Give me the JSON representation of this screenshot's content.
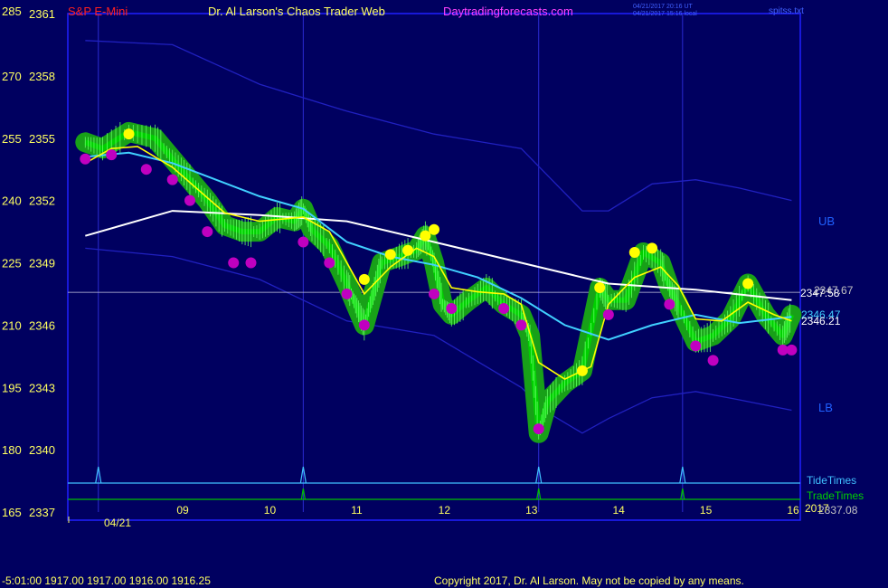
{
  "header": {
    "instrument": "S&P E-Mini",
    "title": "Dr. Al Larson's Chaos Trader Web",
    "site": "Daytradingforecasts.com",
    "stamp_utc": "04/21/2017 20:16 UT",
    "stamp_local": "04/21/2017 15:16 local",
    "file": "spitss.txt"
  },
  "footer": {
    "quote": "-5:01:00  1917.00 1917.00 1916.00 1916.25",
    "copyright": "Copyright 2017, Dr. Al Larson. May not be copied by any means."
  },
  "colors": {
    "background": "#000060",
    "frame": "#2020ff",
    "price": "#00d000",
    "yellow_dot": "#ffff00",
    "magenta_dot": "#c000c0",
    "bands": "#2020c0",
    "cyan_avg": "#40d0ff",
    "white_avg": "#ffffff",
    "yellow_avg": "#ffff00",
    "label_yellow": "#ffff60",
    "tide": "#40c0ff",
    "trade": "#00c000"
  },
  "chart_data": {
    "type": "line",
    "title": "S&P E-Mini",
    "y_left_ticks": [
      "285",
      "270",
      "255",
      "240",
      "225",
      "210",
      "195",
      "180",
      "165"
    ],
    "y_right_ticks": [
      "2361",
      "2358",
      "2355",
      "2352",
      "2349",
      "2346",
      "2343",
      "2340",
      "2337"
    ],
    "ylim": [
      2337,
      2361
    ],
    "x_ticks": [
      "09",
      "10",
      "11",
      "12",
      "13",
      "14",
      "15",
      "16"
    ],
    "x_date": "04/21",
    "band_labels": {
      "upper": "UB",
      "lower": "LB"
    },
    "right_labels": [
      "2347.67",
      "2347.58",
      "2346.47",
      "2346.21",
      "2337.08"
    ],
    "tide_label": "TideTimes",
    "trade_label": "TradeTimes",
    "year_label": "2017",
    "price_series": [
      [
        "8.0",
        2354.8
      ],
      [
        "8.2",
        2354.5
      ],
      [
        "8.5",
        2355.3
      ],
      [
        "8.8",
        2355.0
      ],
      [
        "9.0",
        2354.0
      ],
      [
        "9.2",
        2353.0
      ],
      [
        "9.4",
        2352.0
      ],
      [
        "9.6",
        2350.8
      ],
      [
        "9.8",
        2350.5
      ],
      [
        "10.0",
        2350.5
      ],
      [
        "10.2",
        2351.2
      ],
      [
        "10.4",
        2351.0
      ],
      [
        "10.5",
        2351.6
      ],
      [
        "10.6",
        2350.6
      ],
      [
        "10.8",
        2349.8
      ],
      [
        "11.0",
        2348.0
      ],
      [
        "11.1",
        2347.0
      ],
      [
        "11.2",
        2346.0
      ],
      [
        "11.3",
        2347.5
      ],
      [
        "11.4",
        2349.0
      ],
      [
        "11.6",
        2349.3
      ],
      [
        "11.8",
        2349.6
      ],
      [
        "11.9",
        2350.3
      ],
      [
        "12.0",
        2349.0
      ],
      [
        "12.1",
        2347.0
      ],
      [
        "12.2",
        2346.5
      ],
      [
        "12.4",
        2347.2
      ],
      [
        "12.6",
        2347.8
      ],
      [
        "12.8",
        2347.0
      ],
      [
        "13.0",
        2346.5
      ],
      [
        "13.1",
        2345.5
      ],
      [
        "13.2",
        2340.8
      ],
      [
        "13.3",
        2342.3
      ],
      [
        "13.5",
        2343.2
      ],
      [
        "13.7",
        2343.8
      ],
      [
        "13.9",
        2347.8
      ],
      [
        "14.0",
        2347.2
      ],
      [
        "14.2",
        2347.2
      ],
      [
        "14.4",
        2349.5
      ],
      [
        "14.6",
        2349.0
      ],
      [
        "14.7",
        2347.8
      ],
      [
        "14.8",
        2347.0
      ],
      [
        "15.0",
        2345.2
      ],
      [
        "15.2",
        2345.5
      ],
      [
        "15.4",
        2346.3
      ],
      [
        "15.6",
        2348.0
      ],
      [
        "15.8",
        2346.5
      ],
      [
        "16.0",
        2345.5
      ],
      [
        "16.1",
        2346.5
      ]
    ],
    "upper_band": [
      [
        "8.0",
        2359.7
      ],
      [
        "9.0",
        2359.5
      ],
      [
        "10.0",
        2357.6
      ],
      [
        "11.0",
        2356.3
      ],
      [
        "12.0",
        2355.2
      ],
      [
        "13.0",
        2354.5
      ],
      [
        "13.7",
        2351.5
      ],
      [
        "14.0",
        2351.5
      ],
      [
        "14.5",
        2352.8
      ],
      [
        "15.0",
        2353.0
      ],
      [
        "15.5",
        2352.6
      ],
      [
        "16.1",
        2352.0
      ]
    ],
    "lower_band": [
      [
        "8.0",
        2349.7
      ],
      [
        "9.0",
        2349.3
      ],
      [
        "10.0",
        2348.2
      ],
      [
        "11.0",
        2346.2
      ],
      [
        "12.0",
        2345.5
      ],
      [
        "13.0",
        2343.0
      ],
      [
        "13.3",
        2341.8
      ],
      [
        "13.7",
        2340.8
      ],
      [
        "14.0",
        2341.5
      ],
      [
        "14.5",
        2342.5
      ],
      [
        "15.0",
        2342.8
      ],
      [
        "15.5",
        2342.4
      ],
      [
        "16.1",
        2341.9
      ]
    ],
    "white_avg": [
      [
        "8.0",
        2350.3
      ],
      [
        "9.0",
        2351.5
      ],
      [
        "10.0",
        2351.3
      ],
      [
        "11.0",
        2351.0
      ],
      [
        "12.0",
        2350.0
      ],
      [
        "13.0",
        2349.0
      ],
      [
        "14.0",
        2348.0
      ],
      [
        "15.0",
        2347.7
      ],
      [
        "16.1",
        2347.2
      ]
    ],
    "cyan_avg": [
      [
        "8.0",
        2354.1
      ],
      [
        "8.5",
        2354.3
      ],
      [
        "9.0",
        2353.8
      ],
      [
        "9.5",
        2353.0
      ],
      [
        "10.0",
        2352.2
      ],
      [
        "10.5",
        2351.6
      ],
      [
        "11.0",
        2350.0
      ],
      [
        "11.5",
        2349.3
      ],
      [
        "12.0",
        2348.9
      ],
      [
        "12.5",
        2348.3
      ],
      [
        "13.0",
        2347.3
      ],
      [
        "13.5",
        2346.0
      ],
      [
        "14.0",
        2345.3
      ],
      [
        "14.5",
        2346.0
      ],
      [
        "15.0",
        2346.5
      ],
      [
        "15.5",
        2346.1
      ],
      [
        "16.1",
        2346.4
      ]
    ],
    "yellow_avg": [
      [
        "8.0",
        2353.8
      ],
      [
        "8.3",
        2354.5
      ],
      [
        "8.6",
        2354.6
      ],
      [
        "9.0",
        2353.6
      ],
      [
        "9.3",
        2352.5
      ],
      [
        "9.6",
        2351.4
      ],
      [
        "10.0",
        2351.0
      ],
      [
        "10.5",
        2351.2
      ],
      [
        "10.8",
        2350.5
      ],
      [
        "11.0",
        2349.0
      ],
      [
        "11.2",
        2347.5
      ],
      [
        "11.5",
        2348.8
      ],
      [
        "11.8",
        2349.7
      ],
      [
        "12.0",
        2349.3
      ],
      [
        "12.2",
        2347.8
      ],
      [
        "12.5",
        2347.6
      ],
      [
        "12.8",
        2347.5
      ],
      [
        "13.0",
        2347.0
      ],
      [
        "13.2",
        2344.2
      ],
      [
        "13.5",
        2343.4
      ],
      [
        "13.8",
        2344.0
      ],
      [
        "14.0",
        2347.0
      ],
      [
        "14.3",
        2348.3
      ],
      [
        "14.6",
        2348.8
      ],
      [
        "14.8",
        2347.9
      ],
      [
        "15.0",
        2346.3
      ],
      [
        "15.3",
        2346.2
      ],
      [
        "15.6",
        2347.1
      ],
      [
        "15.9",
        2346.5
      ],
      [
        "16.1",
        2346.2
      ]
    ],
    "yellow_dots": [
      [
        "8.5",
        2355.2
      ],
      [
        "11.2",
        2348.2
      ],
      [
        "11.5",
        2349.4
      ],
      [
        "11.7",
        2349.6
      ],
      [
        "11.9",
        2350.3
      ],
      [
        "12.0",
        2350.6
      ],
      [
        "13.7",
        2343.8
      ],
      [
        "13.9",
        2347.8
      ],
      [
        "14.3",
        2349.5
      ],
      [
        "14.5",
        2349.7
      ],
      [
        "15.6",
        2348.0
      ]
    ],
    "magenta_dots": [
      [
        "8.0",
        2354.0
      ],
      [
        "8.3",
        2354.2
      ],
      [
        "8.7",
        2353.5
      ],
      [
        "9.0",
        2353.0
      ],
      [
        "9.2",
        2352.0
      ],
      [
        "9.4",
        2350.5
      ],
      [
        "9.7",
        2349.0
      ],
      [
        "9.9",
        2349.0
      ],
      [
        "10.5",
        2350.0
      ],
      [
        "10.8",
        2349.0
      ],
      [
        "11.0",
        2347.5
      ],
      [
        "11.2",
        2346.0
      ],
      [
        "12.0",
        2347.5
      ],
      [
        "12.2",
        2346.8
      ],
      [
        "12.8",
        2346.8
      ],
      [
        "13.0",
        2346.0
      ],
      [
        "13.2",
        2341.0
      ],
      [
        "14.0",
        2346.5
      ],
      [
        "14.7",
        2347.0
      ],
      [
        "15.0",
        2345.0
      ],
      [
        "15.2",
        2344.3
      ],
      [
        "16.0",
        2344.8
      ],
      [
        "16.1",
        2344.8
      ]
    ],
    "tide_times": [
      "8.15",
      "10.5",
      "13.2",
      "14.85"
    ],
    "trade_times": [
      "10.5",
      "13.2",
      "14.85"
    ],
    "grid": false,
    "legend_position": "right"
  }
}
